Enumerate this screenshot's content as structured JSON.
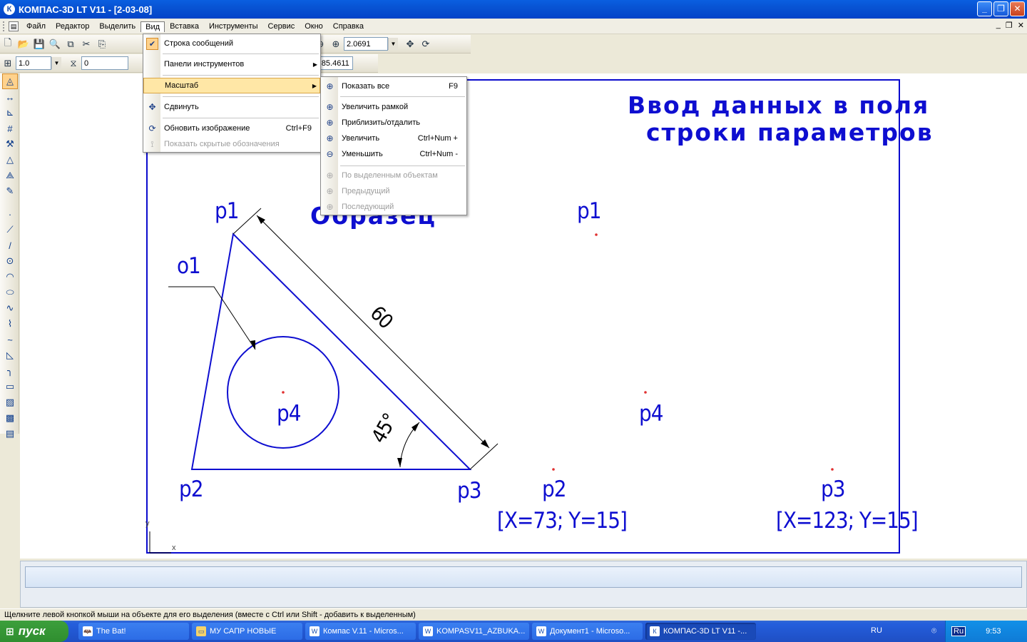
{
  "window": {
    "title": "КОМПАС-3D LT V11 - [2-03-08]"
  },
  "menubar": {
    "items": [
      "Файл",
      "Редактор",
      "Выделить",
      "Вид",
      "Вставка",
      "Инструменты",
      "Сервис",
      "Окно",
      "Справка"
    ],
    "open_index": 3
  },
  "toolbar1": {
    "scale_value": "2.0691"
  },
  "toolbar2": {
    "step_value": "1.0",
    "layer_value": "0",
    "angle_label": "5С",
    "angle_value": "85.4611"
  },
  "view_menu": {
    "items": [
      {
        "label": "Строка сообщений",
        "checked": true
      },
      {
        "label": "Панели инструментов",
        "submenu": true
      },
      {
        "label": "Масштаб",
        "submenu": true,
        "highlighted": true
      },
      {
        "label": "Сдвинуть"
      },
      {
        "label": "Обновить изображение",
        "shortcut": "Ctrl+F9"
      },
      {
        "label": "Показать скрытые обозначения",
        "disabled": true
      }
    ]
  },
  "scale_submenu": {
    "items": [
      {
        "label": "Показать все",
        "shortcut": "F9"
      },
      {
        "label": "Увеличить рамкой"
      },
      {
        "label": "Приблизить/отдалить"
      },
      {
        "label": "Увеличить",
        "shortcut": "Ctrl+Num +"
      },
      {
        "label": "Уменьшить",
        "shortcut": "Ctrl+Num -"
      },
      {
        "label": "По выделенным объектам",
        "disabled": true
      },
      {
        "label": "Предыдущий",
        "disabled": true
      },
      {
        "label": "Последующий",
        "disabled": true
      }
    ]
  },
  "drawing": {
    "title_line1": "Ввод данных в поля",
    "title_line2": "строки параметров",
    "sample_label": "Образец",
    "left": {
      "p1": "p1",
      "o1": "o1",
      "p4": "p4",
      "p2": "p2",
      "p3": "p3",
      "dim_length": "60",
      "dim_angle": "45°"
    },
    "right": {
      "p1": "p1",
      "p4": "p4",
      "p2": "p2",
      "p3": "p3",
      "p2_coords": "[X=73; Y=15]",
      "p3_coords": "[X=123; Y=15]"
    },
    "axis_x": "x",
    "axis_y": "y",
    "line_color": "#0E0ED0",
    "point_color": "#E03030"
  },
  "statusbar": {
    "message": "Щелкните левой кнопкой мыши на объекте для его выделения (вместе с Ctrl или Shift - добавить к выделенным)"
  },
  "taskbar": {
    "start_label": "пуск",
    "tasks": [
      {
        "label": "The Bat!",
        "active": false
      },
      {
        "label": "МУ САПР НОВЫЕ",
        "active": false
      },
      {
        "label": "Компас V.11 - Micros...",
        "active": false
      },
      {
        "label": "KOMPASV11_AZBUKA...",
        "active": false
      },
      {
        "label": "Документ1 - Microso...",
        "active": false
      },
      {
        "label": "КОМПАС-3D LT V11 -...",
        "active": true
      }
    ],
    "lang": "RU",
    "lang_indicator": "Ru",
    "clock": "9:53"
  }
}
